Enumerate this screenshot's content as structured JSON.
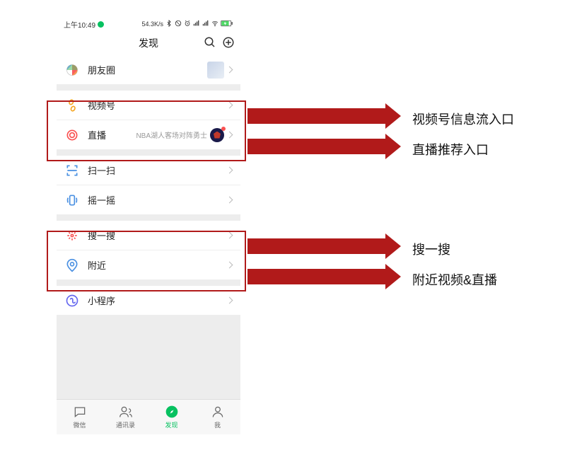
{
  "status": {
    "time": "上午10:49",
    "speed": "54.3K/s"
  },
  "header": {
    "title": "发现"
  },
  "rows": {
    "moments": "朋友圈",
    "channels": "视频号",
    "live": "直播",
    "live_extra": "NBA湖人客场对阵勇士",
    "scan": "扫一扫",
    "shake": "摇一摇",
    "search": "搜一搜",
    "nearby": "附近",
    "miniapp": "小程序"
  },
  "tabs": {
    "chat": "微信",
    "contacts": "通讯录",
    "discover": "发现",
    "me": "我"
  },
  "annotations": {
    "a1": "视频号信息流入口",
    "a2": "直播推荐入口",
    "a3": "搜一搜",
    "a4": "附近视频&直播"
  }
}
